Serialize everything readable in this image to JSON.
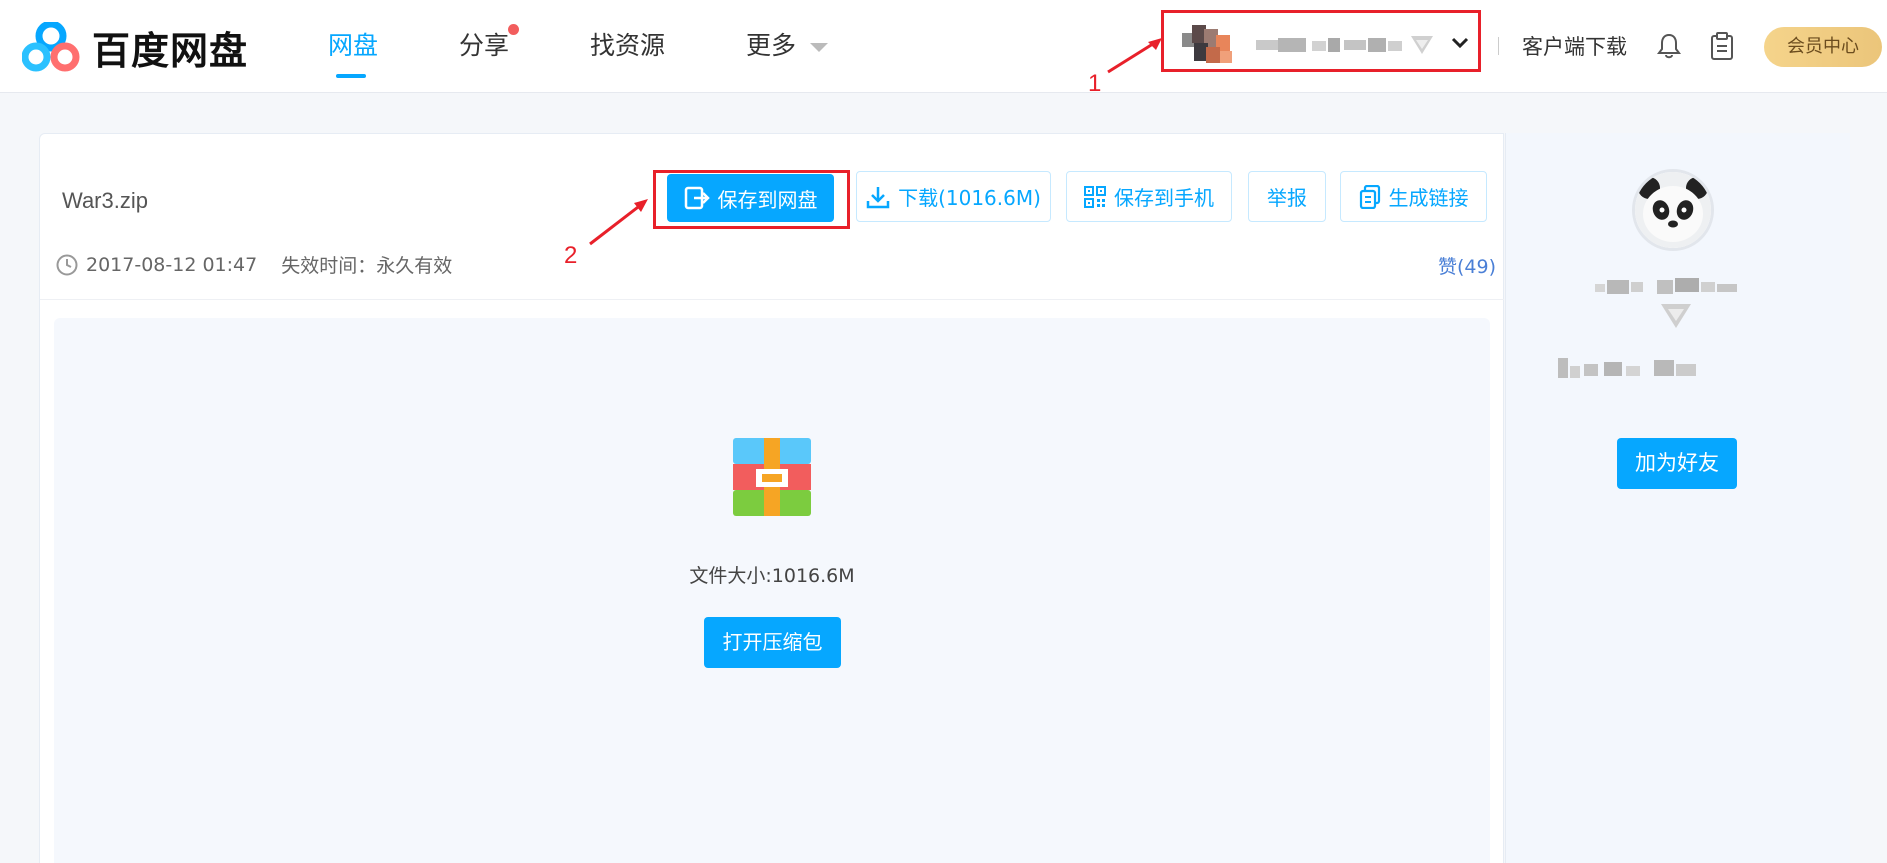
{
  "header": {
    "brand": "百度网盘",
    "nav": [
      {
        "label": "网盘",
        "active": true
      },
      {
        "label": "分享",
        "badge": true
      },
      {
        "label": "找资源"
      },
      {
        "label": "更多"
      }
    ],
    "client_download": "客户端下载",
    "vip_center": "会员中心"
  },
  "annotations": {
    "one": "1",
    "two": "2"
  },
  "file": {
    "name": "War3.zip",
    "date": "2017-08-12 01:47",
    "expire": "失效时间：永久有效",
    "likes": "赞(49)",
    "size_label": "文件大小:1016.6M"
  },
  "actions": {
    "save_to_disk": "保存到网盘",
    "download": "下载(1016.6M)",
    "save_to_phone": "保存到手机",
    "report": "举报",
    "gen_link": "生成链接",
    "open_zip": "打开压缩包"
  },
  "side": {
    "add_friend": "加为好友"
  },
  "colors": {
    "primary": "#06a7ff",
    "annotation_red": "#e8202a",
    "vip_gold": "#f0cd84"
  }
}
